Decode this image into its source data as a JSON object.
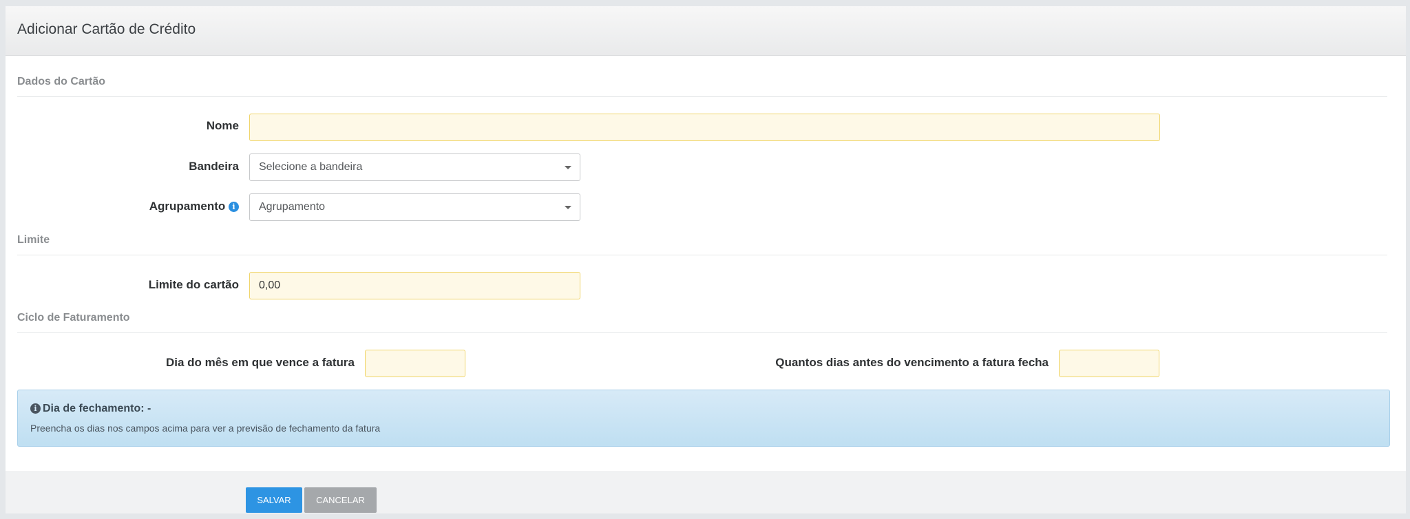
{
  "panel": {
    "title": "Adicionar Cartão de Crédito"
  },
  "sections": {
    "card_data": "Dados do Cartão",
    "limit": "Limite",
    "billing_cycle": "Ciclo de Faturamento"
  },
  "fields": {
    "nome": {
      "label": "Nome",
      "value": ""
    },
    "bandeira": {
      "label": "Bandeira",
      "placeholder": "Selecione a bandeira"
    },
    "agrupamento": {
      "label": "Agrupamento",
      "placeholder": "Agrupamento",
      "help_icon": "info-icon"
    },
    "limite": {
      "label": "Limite do cartão",
      "value": "0,00"
    },
    "dia_vencimento": {
      "label": "Dia do mês em que vence a fatura",
      "value": ""
    },
    "dias_antes": {
      "label": "Quantos dias antes do vencimento a fatura fecha",
      "value": ""
    }
  },
  "alert": {
    "icon": "info-icon",
    "title": "Dia de fechamento: -",
    "text": "Preencha os dias nos campos acima para ver a previsão de fechamento da fatura"
  },
  "footer": {
    "save_label": "Salvar",
    "cancel_label": "Cancelar"
  },
  "colors": {
    "primary": "#2d94e3",
    "required_field_bg": "#fef9e7",
    "required_field_border": "#f0d56a",
    "alert_bg": "#c9e4f5",
    "cancel": "#a5a8ab"
  }
}
